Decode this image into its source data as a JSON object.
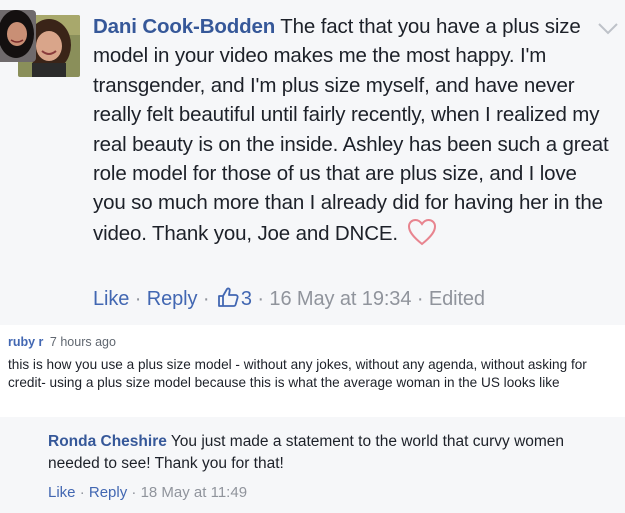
{
  "comment1": {
    "author": "Dani Cook-Bodden",
    "text": "The fact that you have a plus size model in your video makes me the most happy. I'm transgender, and I'm plus size myself, and have never really felt beautiful until fairly recently, when I realized my real beauty is on the inside. Ashley has been such a great role model for those of us that are plus size, and I love you so much more than I already did for having her in the video. Thank you, Joe and DNCE.",
    "like_label": "Like",
    "reply_label": "Reply",
    "like_count": "3",
    "timestamp": "16 May at 19:34",
    "edited_label": "Edited",
    "separator": " · "
  },
  "comment2": {
    "username": "ruby r",
    "time": "7 hours ago",
    "text": "this is how you use a plus size model - without any jokes, without any agenda, without asking for credit- using a plus size model because this is what the average woman in the US looks like"
  },
  "comment3": {
    "author": "Ronda Cheshire",
    "text": "You just made a statement to the world that curvy women needed to see! Thank you for that!",
    "like_label": "Like",
    "reply_label": "Reply",
    "timestamp": "18 May at 11:49",
    "separator": " · "
  },
  "colors": {
    "link": "#4267b2",
    "name": "#365899",
    "meta": "#90949c",
    "text": "#1d2129",
    "panel": "#f6f7f9",
    "heart": "#e8848f"
  }
}
